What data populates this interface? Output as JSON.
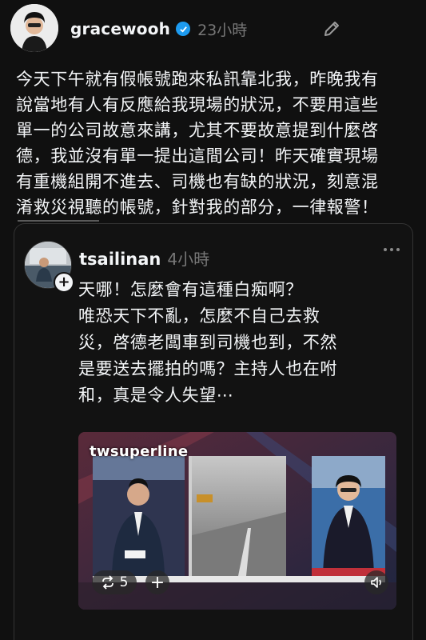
{
  "post": {
    "username": "gracewooh",
    "time": "23小時",
    "text": "今天下午就有假帳號跑來私訊靠北我，昨晚我有\n說當地有人有反應給我現場的狀況，不要用這些\n單一的公司故意來講，尤其不要故意提到什麼啓\n德，我並沒有單一提出這間公司！昨天確實現場\n有重機組開不進去、司機也有缺的狀況，刻意混\n淆救災視聽的帳號，針對我的部分，一律報警！"
  },
  "quote": {
    "username": "tsailinan",
    "time": "4小時",
    "text": "天哪！怎麼會有這種白痴啊？\n唯恐天下不亂，怎麼不自己去救\n災，啓德老闆車到司機也到，不然\n是要送去擺拍的嗎？主持人也在咐\n和，真是令人失望⋯",
    "video": {
      "watermark": "twsuperline",
      "repost_count": "5",
      "add_label": "+"
    }
  },
  "icons": {
    "verified": "verified-badge-icon",
    "edit": "edit-pencil-icon",
    "more": "more-dots-icon",
    "follow": "plus-follow-icon",
    "repost": "repost-icon",
    "volume": "volume-icon"
  },
  "colors": {
    "background": "#101010",
    "text": "#f3f5f7",
    "muted": "#777777",
    "verified": "#1d9bf0"
  }
}
